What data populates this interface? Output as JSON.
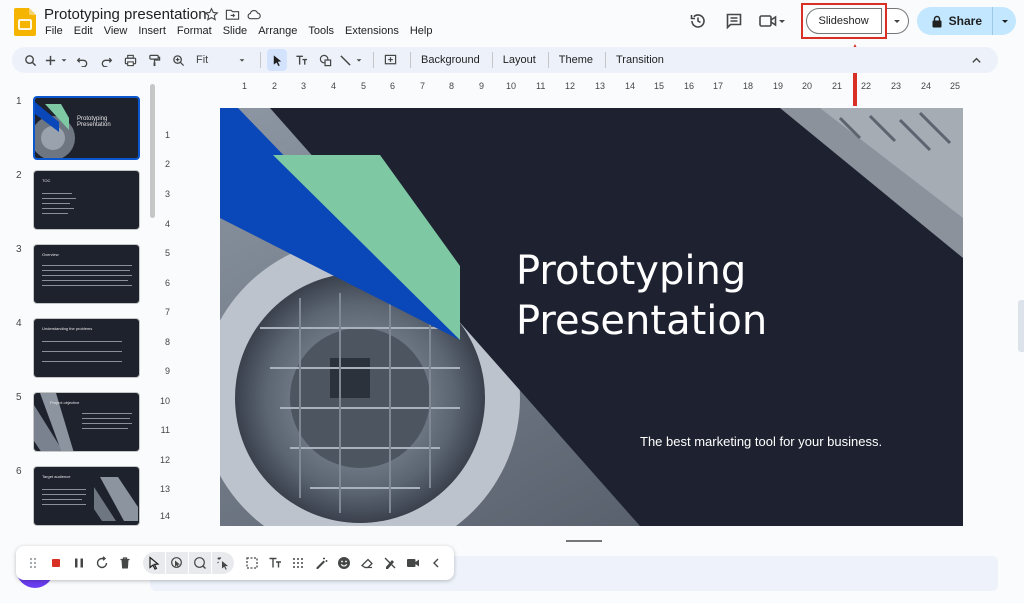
{
  "header": {
    "title": "Prototyping presentation",
    "menu": [
      "File",
      "Edit",
      "View",
      "Insert",
      "Format",
      "Slide",
      "Arrange",
      "Tools",
      "Extensions",
      "Help"
    ],
    "slideshow_label": "Slideshow",
    "share_label": "Share"
  },
  "toolbar": {
    "zoom_label": "Fit",
    "background_label": "Background",
    "layout_label": "Layout",
    "theme_label": "Theme",
    "transition_label": "Transition"
  },
  "ruler": {
    "horizontal": [
      "1",
      "2",
      "3",
      "4",
      "5",
      "6",
      "7",
      "8",
      "9",
      "10",
      "11",
      "12",
      "13",
      "14",
      "15",
      "16",
      "17",
      "18",
      "19",
      "20",
      "21",
      "22",
      "23",
      "24",
      "25"
    ],
    "vertical": [
      "1",
      "2",
      "3",
      "4",
      "5",
      "6",
      "7",
      "8",
      "9",
      "10",
      "11",
      "12",
      "13",
      "14"
    ]
  },
  "filmstrip": {
    "slides": [
      {
        "number": "1",
        "title": "Prototyping Presentation"
      },
      {
        "number": "2",
        "title": "TOC"
      },
      {
        "number": "3",
        "title": "Overview"
      },
      {
        "number": "4",
        "title": "Understanding the problems"
      },
      {
        "number": "5",
        "title": "Project objective"
      },
      {
        "number": "6",
        "title": "Target audience"
      }
    ]
  },
  "slide": {
    "title_line1": "Prototyping",
    "title_line2": "Presentation",
    "subtitle": "The best marketing tool for your business."
  },
  "colors": {
    "slide_bg": "#1e2230",
    "accent_blue": "#0a47b8",
    "accent_green": "#7ec8a4",
    "highlight_red": "#d93025",
    "share_bg": "#c2e7ff"
  }
}
